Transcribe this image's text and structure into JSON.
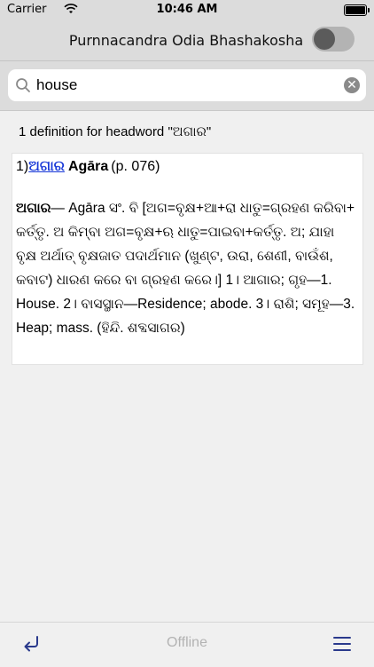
{
  "status_bar": {
    "carrier": "Carrier",
    "time": "10:46 AM"
  },
  "header": {
    "title": "Purnnacandra Odia Bhashakosha"
  },
  "search": {
    "value": "house"
  },
  "results": {
    "summary": "1 definition for headword \"ଅଗାର\""
  },
  "entry": {
    "number": "1)",
    "headword": "ଅଗାର",
    "transliteration": "Agāra",
    "page": "(p. 076)",
    "definition_head": "ଅଗାର",
    "definition_body": "— Agāra ସଂ. ବି [ଅଗ=ବୃକ୍ଷ+ଆ+ରା ଧାତୁ=ଗ୍ରହଣ କରିବା+ କର୍ତ୍ତୃ. ଅ କିମ୍ବା ଅଗ=ବୃକ୍ଷ+ଋ ଧାତୁ=ପାଇବା+କର୍ତ୍ତୃ. ଅ; ଯାହା ବୃକ୍ଷ ଅର୍ଥାତ୍ ବୃକ୍ଷଜାତ ପଦାର୍ଥମାନ (ଖୁଣ୍ଟ, ଉରା, ଶେଣୀ, ବାଉଁଶ, କବାଟ) ଧାରଣ କରେ ବା ଗ୍ରହଣ କରେ।] 1। ଆଗାର; ଗୃହ—1. House. 2। ବାସସ୍ଥାନ—Residence; abode. 3। ରାଶି; ସମୂହ—3. Heap; mass. (ହିନ୍ଦି. ଶବ୍ଦସାଗର)"
  },
  "tab_bar": {
    "status": "Offline"
  },
  "colors": {
    "link": "#1a3ad8",
    "nav_background": "#dcdcdc",
    "icon_tint": "#2a3a8c"
  },
  "icons": [
    "wifi-icon",
    "battery-icon",
    "toggle-switch",
    "search-icon",
    "clear-icon",
    "back-icon",
    "menu-icon"
  ]
}
